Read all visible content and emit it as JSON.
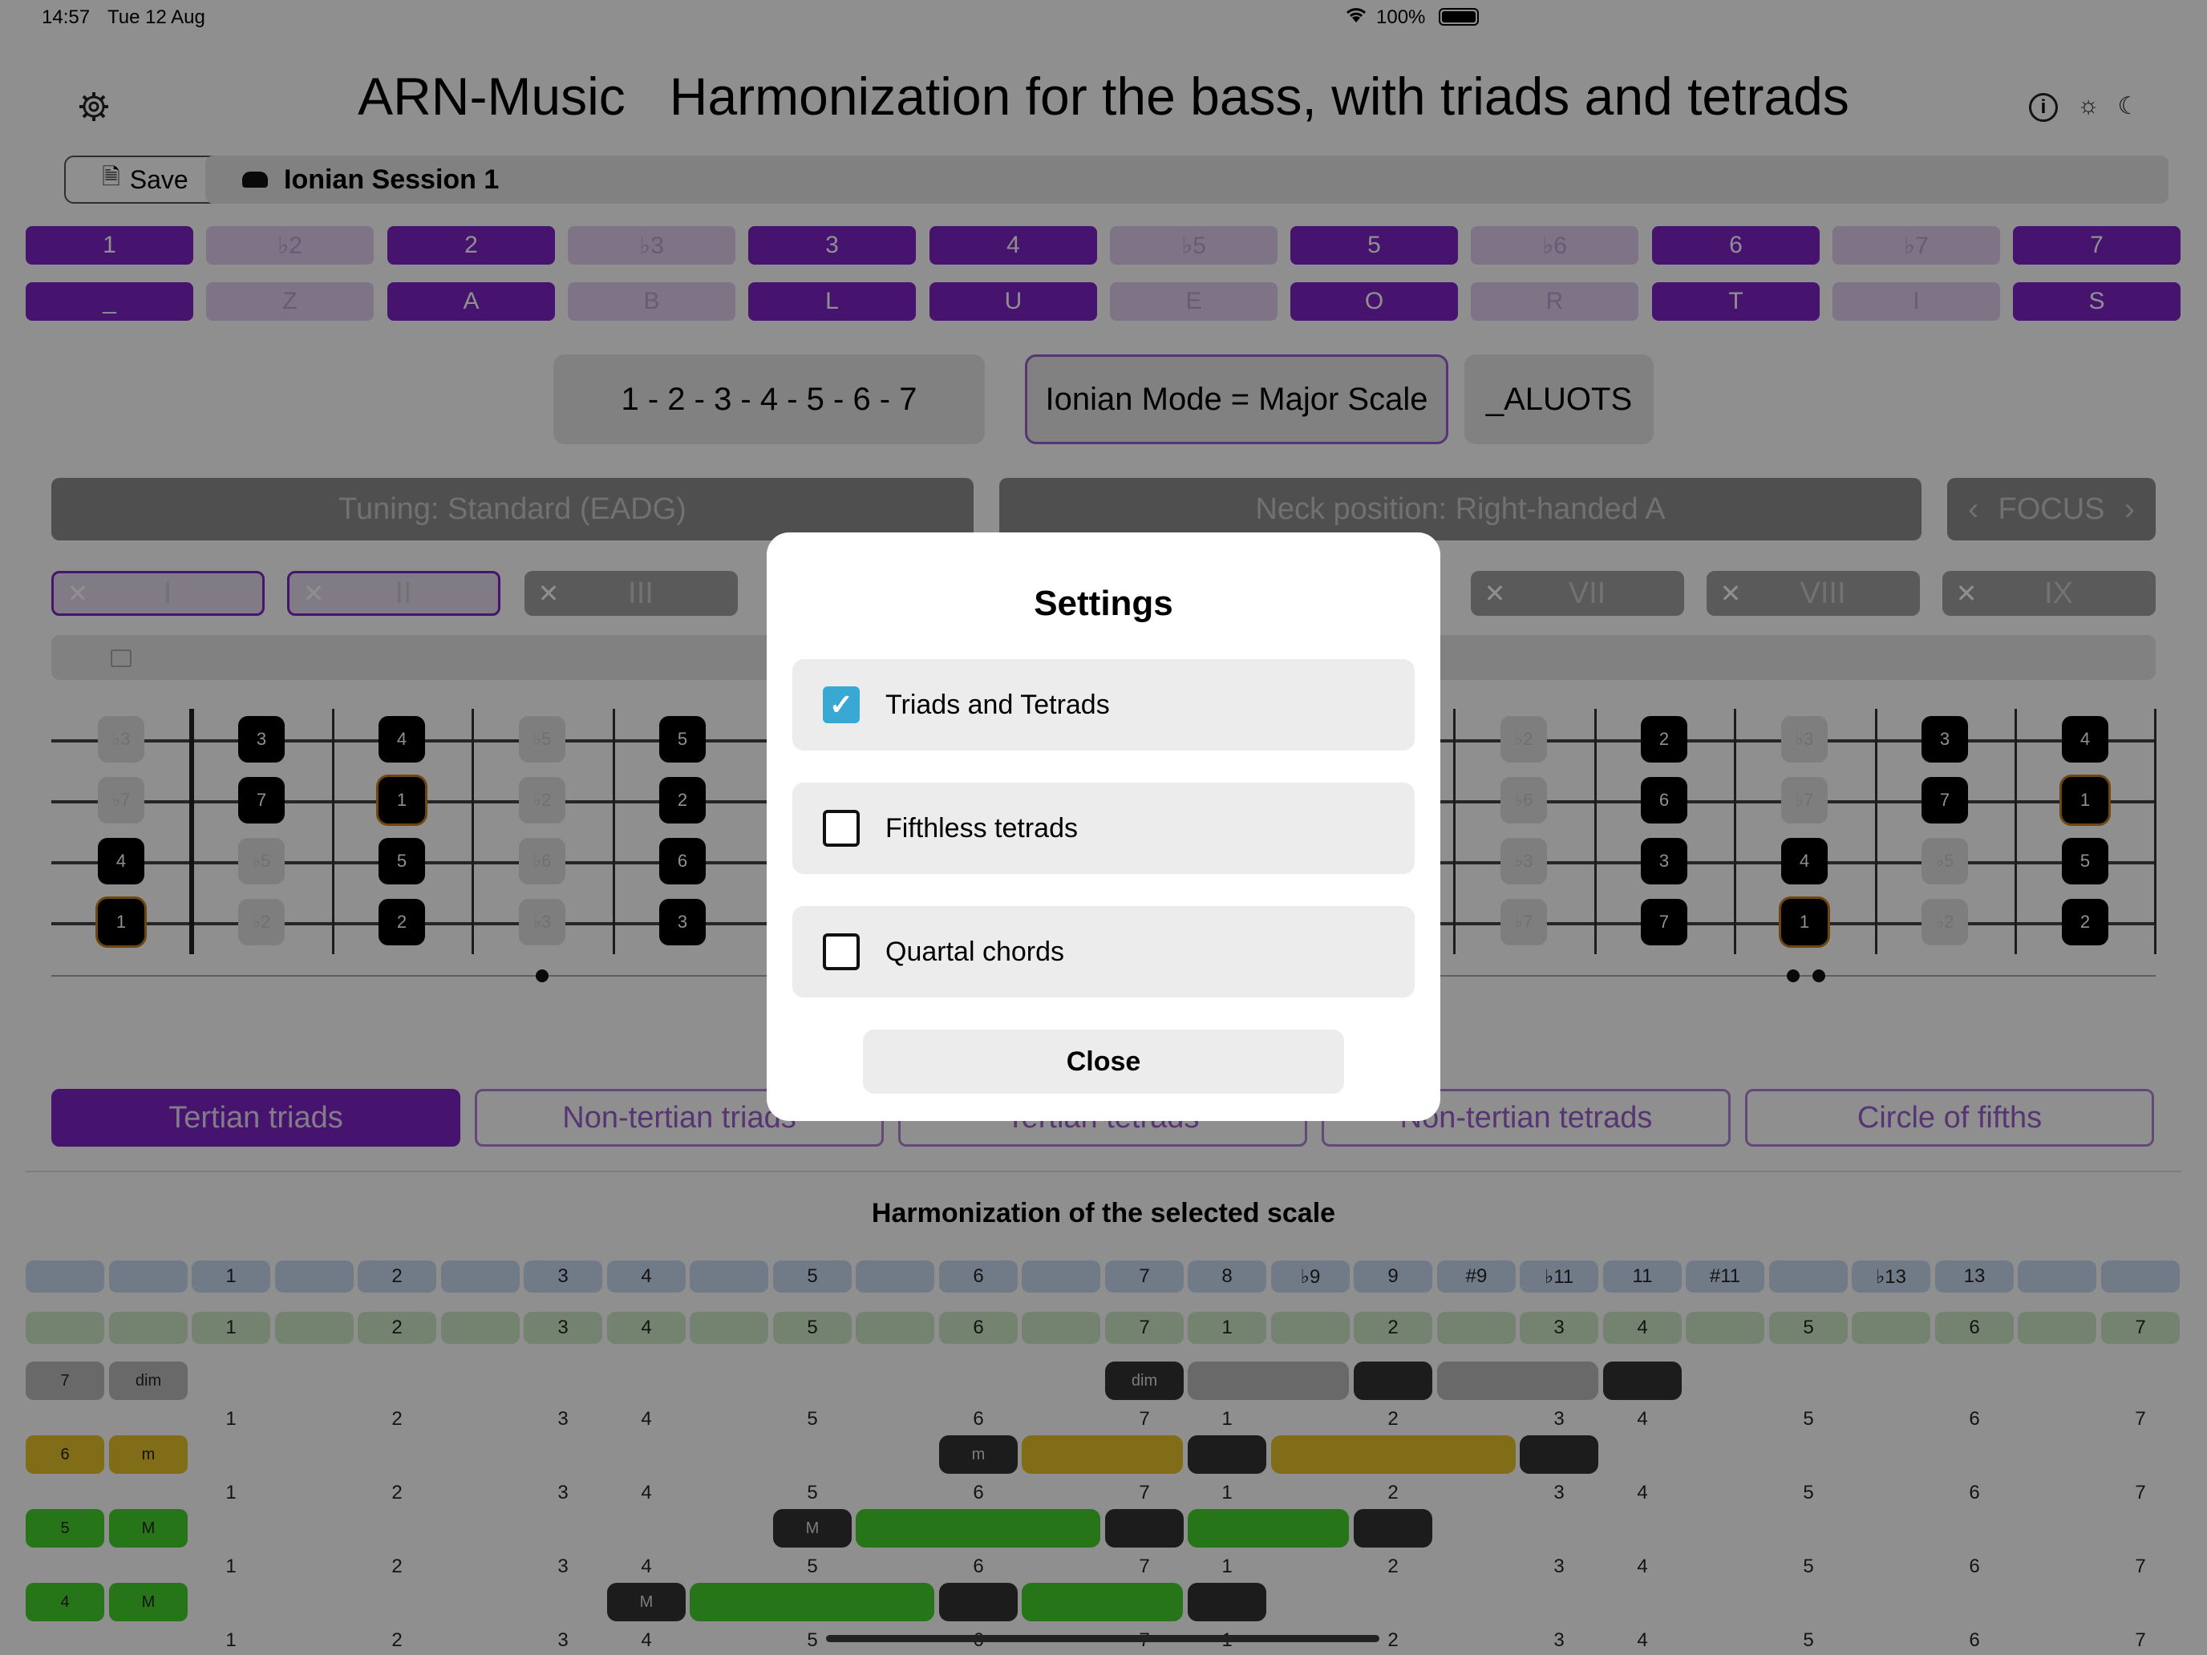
{
  "status": {
    "time": "14:57",
    "date": "Tue 12 Aug",
    "battery": "100%"
  },
  "header": {
    "title": "ARN-Music   Harmonization for the bass, with triads and tetrads",
    "settings_icon": "gear-icon",
    "info_icon": "info-icon",
    "light_icon": "sun-icon",
    "dark_icon": "moon-icon"
  },
  "toolbar": {
    "save_label": "Save",
    "session_name": "Ionian Session 1",
    "session_icon": "cloud-icon"
  },
  "degrees": [
    "1",
    "♭2",
    "2",
    "♭3",
    "3",
    "4",
    "♭5",
    "5",
    "♭6",
    "6",
    "♭7",
    "7"
  ],
  "letters": [
    "_",
    "Z",
    "A",
    "B",
    "L",
    "U",
    "E",
    "O",
    "R",
    "T",
    "I",
    "S"
  ],
  "degree_active": [
    true,
    false,
    true,
    false,
    true,
    true,
    false,
    true,
    false,
    true,
    false,
    true
  ],
  "scale": {
    "formula": "1 - 2 - 3 - 4 - 5 - 6 - 7",
    "mode": "Ionian Mode = Major Scale",
    "word": "_ALUOTS"
  },
  "tuning": {
    "label": "Tuning: Standard (EADG)",
    "neck": "Neck position: Right-handed A",
    "focus": "FOCUS"
  },
  "positions": [
    "I",
    "II",
    "III",
    "VII",
    "VIII",
    "IX"
  ],
  "fretboard": {
    "left": [
      [
        "♭3",
        "3",
        "4",
        "♭5",
        "5"
      ],
      [
        "♭7",
        "7",
        "1",
        "♭2",
        "2"
      ],
      [
        "4",
        "♭5",
        "5",
        "♭6",
        "6"
      ],
      [
        "1",
        "♭2",
        "2",
        "♭3",
        "3"
      ]
    ],
    "right": [
      [
        "♭2",
        "2",
        "♭3",
        "3",
        "4"
      ],
      [
        "♭6",
        "6",
        "♭7",
        "7",
        "1"
      ],
      [
        "♭3",
        "3",
        "4",
        "♭5",
        "5"
      ],
      [
        "♭7",
        "7",
        "1",
        "♭2",
        "2"
      ]
    ]
  },
  "tabs": [
    "Tertian triads",
    "Non-tertian triads",
    "Tertian tetrads",
    "Non-tertian tetrads",
    "Circle of fifths"
  ],
  "harmonization": {
    "title": "Harmonization of the selected scale",
    "top_row": [
      "",
      "",
      "1",
      "",
      "2",
      "",
      "3",
      "4",
      "",
      "5",
      "",
      "6",
      "",
      "7",
      "8",
      "♭9",
      "9",
      "#9",
      "♭11",
      "11",
      "#11",
      "",
      "♭13",
      "13",
      "",
      ""
    ],
    "green_row": [
      "",
      "",
      "1",
      "",
      "2",
      "",
      "3",
      "4",
      "",
      "5",
      "",
      "6",
      "",
      "7",
      "1",
      "",
      "2",
      "",
      "3",
      "4",
      "",
      "5",
      "",
      "6",
      "",
      "7"
    ],
    "chords": [
      {
        "degree": "7",
        "quality": "dim",
        "label": "dim",
        "color": "#bcbcbc"
      },
      {
        "degree": "6",
        "quality": "m",
        "label": "m",
        "color": "#e7c12c"
      },
      {
        "degree": "5",
        "quality": "M",
        "label": "M",
        "color": "#46d12d"
      },
      {
        "degree": "4",
        "quality": "M",
        "label": "M",
        "color": "#46d12d"
      }
    ],
    "number_row": [
      "1",
      "2",
      "3",
      "4",
      "5",
      "6",
      "7",
      "1",
      "2",
      "3",
      "4",
      "5",
      "6",
      "7"
    ]
  },
  "modal": {
    "title": "Settings",
    "options": [
      {
        "label": "Triads and Tetrads",
        "checked": true
      },
      {
        "label": "Fifthless tetrads",
        "checked": false
      },
      {
        "label": "Quartal chords",
        "checked": false
      }
    ],
    "close_label": "Close"
  }
}
